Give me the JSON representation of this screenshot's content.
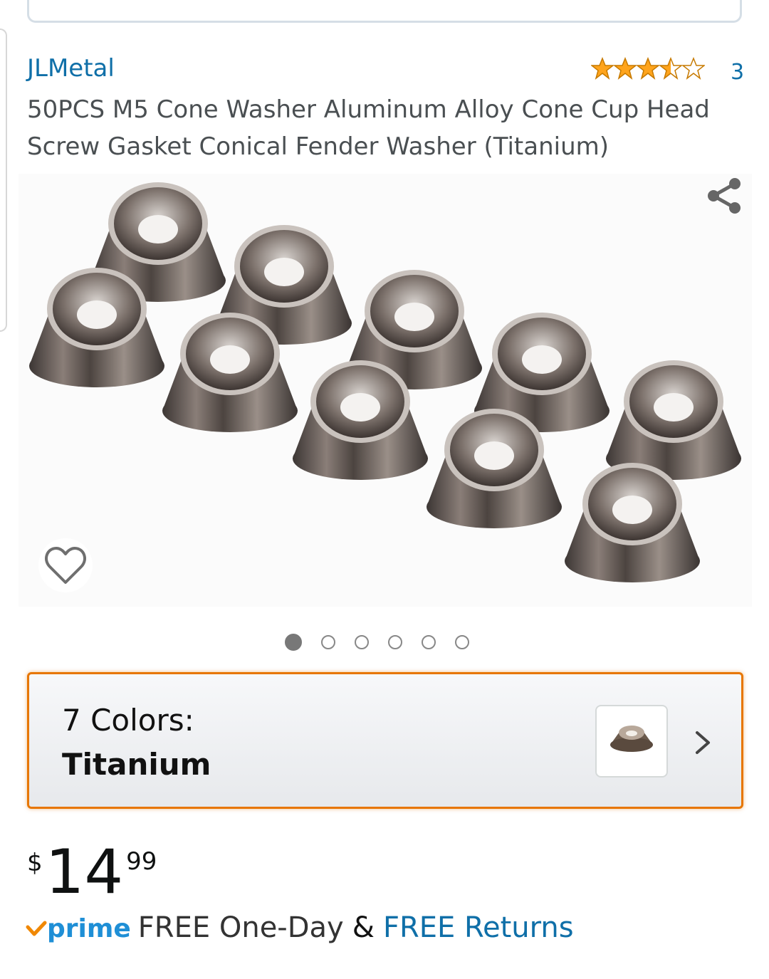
{
  "product": {
    "brand": "JLMetal",
    "rating_stars": 3.5,
    "rating_count": "3",
    "title": "50PCS M5 Cone Washer Aluminum Alloy Cone Cup Head Screw Gasket Conical Fender Washer (Titanium)"
  },
  "gallery": {
    "image_count": 6,
    "active_index": 0,
    "share_icon": "share-icon",
    "wishlist_icon": "heart-icon"
  },
  "variant": {
    "label": "7 Colors:",
    "value": "Titanium"
  },
  "price": {
    "symbol": "$",
    "whole": "14",
    "fraction": "99"
  },
  "shipping": {
    "prime_label": "prime",
    "delivery": "FREE One-Day",
    "amp": "&",
    "returns": "FREE Returns"
  },
  "colors": {
    "link": "#0f6fa8",
    "star": "#ffa41c",
    "highlight": "#e77600",
    "prime": "#1f8fd6"
  }
}
